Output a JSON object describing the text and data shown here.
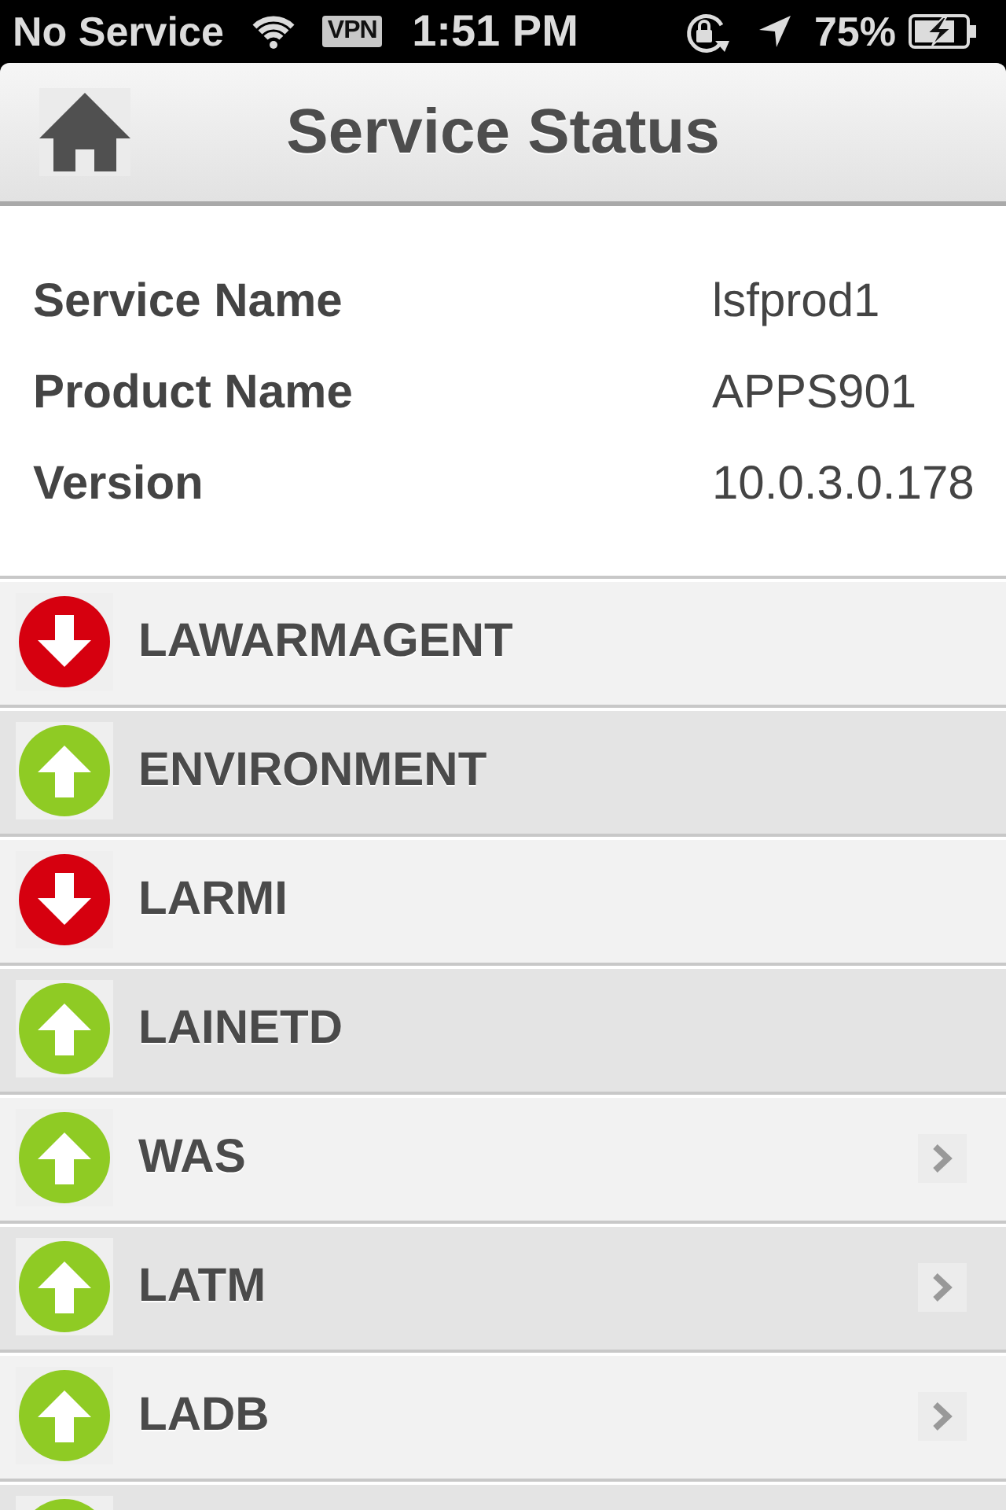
{
  "status_bar": {
    "carrier": "No Service",
    "vpn": "VPN",
    "time": "1:51 PM",
    "battery": "75%"
  },
  "nav_bar": {
    "title": "Service Status"
  },
  "service_info": [
    {
      "label": "Service Name",
      "value": "lsfprod1"
    },
    {
      "label": "Product Name",
      "value": "APPS901"
    },
    {
      "label": "Version",
      "value": "10.0.3.0.178"
    }
  ],
  "services": [
    {
      "name": "LAWARMAGENT",
      "online": false,
      "disclosure": false
    },
    {
      "name": "ENVIRONMENT",
      "online": true,
      "disclosure": false
    },
    {
      "name": "LARMI",
      "online": false,
      "disclosure": false
    },
    {
      "name": "LAINETD",
      "online": true,
      "disclosure": false
    },
    {
      "name": "WAS",
      "online": true,
      "disclosure": true
    },
    {
      "name": "LATM",
      "online": true,
      "disclosure": true
    },
    {
      "name": "LADB",
      "online": true,
      "disclosure": true
    },
    {
      "online": true,
      "disclosure": false
    }
  ]
}
